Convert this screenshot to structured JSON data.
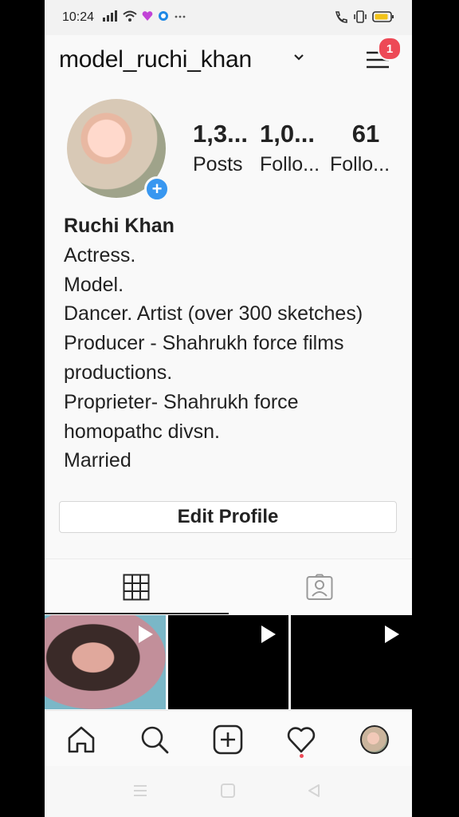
{
  "status_bar": {
    "time": "10:24"
  },
  "header": {
    "username": "model_ruchi_khan",
    "notification_count": "1"
  },
  "profile": {
    "stats": [
      {
        "count": "1,3...",
        "label": "Posts"
      },
      {
        "count": "1,0...",
        "label": "Follo..."
      },
      {
        "count": "61",
        "label": "Follo..."
      }
    ],
    "name": "Ruchi Khan",
    "bio_lines": [
      "Actress.",
      "Model.",
      "Dancer. Artist (over 300 sketches)",
      "Producer - Shahrukh force films",
      "productions.",
      "Proprieter- Shahrukh force",
      "homopathc divsn.",
      "Married"
    ],
    "edit_profile_label": "Edit Profile"
  },
  "tabs": {
    "grid_icon": "grid-icon",
    "tagged_icon": "tagged-icon"
  },
  "bottom_nav": [
    "home-icon",
    "search-icon",
    "add-post-icon",
    "heart-icon",
    "profile-avatar"
  ],
  "colors": {
    "badge": "#ed4956",
    "accent": "#3897f0"
  }
}
